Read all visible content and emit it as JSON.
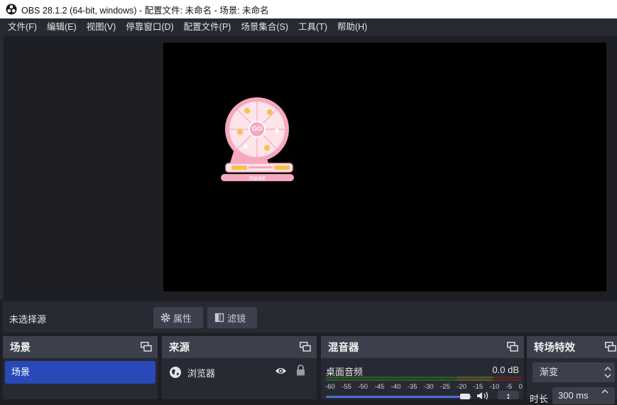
{
  "window": {
    "title": "OBS 28.1.2 (64-bit, windows) - 配置文件: 未命名 - 场景: 未命名"
  },
  "menu": [
    "文件(F)",
    "编辑(E)",
    "视图(V)",
    "停靠窗口(D)",
    "配置文件(P)",
    "场景集合(S)",
    "工具(T)",
    "帮助(H)"
  ],
  "source_toolbar": {
    "status": "未选择源",
    "properties_label": "属性",
    "filters_label": "滤镜"
  },
  "docks": {
    "scenes": {
      "title": "场景",
      "items": [
        "场景"
      ]
    },
    "sources": {
      "title": "来源",
      "items": [
        {
          "name": "浏览器",
          "visible": true,
          "locked": true
        }
      ]
    },
    "mixer": {
      "title": "混音器",
      "channel": {
        "name": "桌面音频",
        "level": "0.0 dB"
      },
      "scale": [
        "-60",
        "-55",
        "-50",
        "-45",
        "-40",
        "-35",
        "-30",
        "-25",
        "-20",
        "-15",
        "-10",
        "-5",
        "0"
      ],
      "volume_fraction": 0.95
    },
    "transitions": {
      "title": "转场特效",
      "selected": "渐变",
      "duration_label": "时长",
      "duration_value": "300 ms"
    }
  },
  "preview": {
    "wheel_center_label": "GO",
    "wheel_button_label": "开始抽奖",
    "colors": {
      "pink": "#f7a8bf",
      "light_pink": "#fde3ea",
      "gold": "#f5c24a"
    }
  },
  "colors": {
    "accent": "#2849b7",
    "panel": "#272a33",
    "header": "#3c404d",
    "canvas": "#000000"
  }
}
